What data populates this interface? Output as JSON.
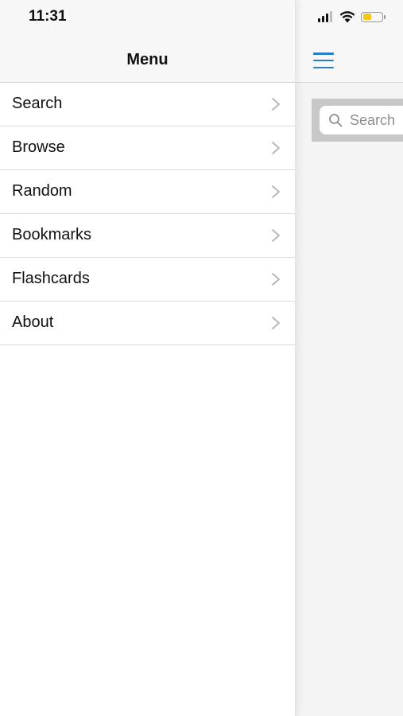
{
  "status_bar": {
    "time": "11:31",
    "battery_level": 0.45,
    "battery_color": "#f5c518"
  },
  "drawer": {
    "title": "Menu",
    "items": [
      {
        "label": "Search"
      },
      {
        "label": "Browse"
      },
      {
        "label": "Random"
      },
      {
        "label": "Bookmarks"
      },
      {
        "label": "Flashcards"
      },
      {
        "label": "About"
      }
    ]
  },
  "main": {
    "search": {
      "placeholder": "Search",
      "value": ""
    },
    "accent_color": "#2a7fc4"
  },
  "icons": {
    "menu_toggle": "hamburger-menu-icon",
    "search": "search-icon",
    "row_disclosure": "chevron-right-icon",
    "signal": "cellular-signal-icon",
    "wifi": "wifi-icon",
    "battery": "battery-icon"
  }
}
